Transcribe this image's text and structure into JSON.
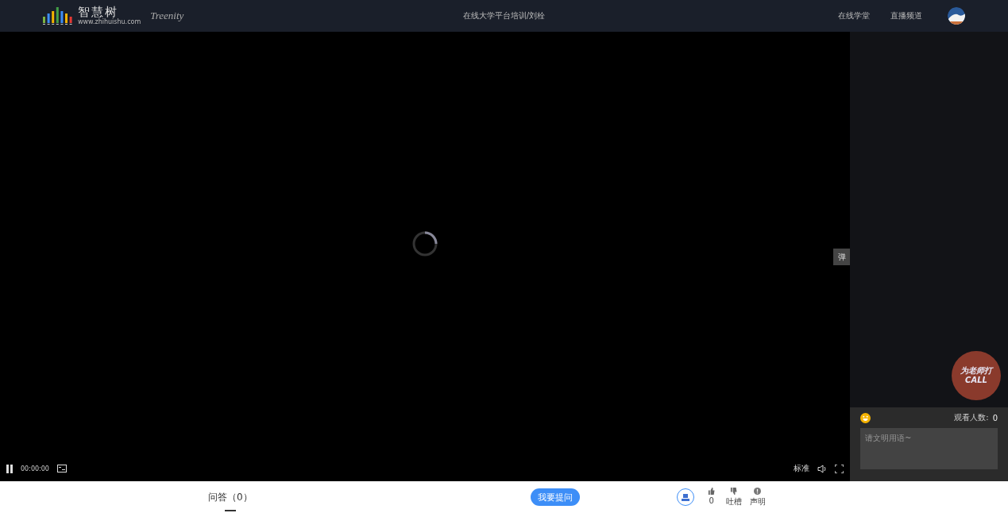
{
  "header": {
    "logo_text": "智慧树",
    "logo_url": "www.zhihuishu.com",
    "brand": "Treenity",
    "title": "在线大学平台培训/刘栓",
    "nav": [
      {
        "label": "在线学堂"
      },
      {
        "label": "直播频道"
      }
    ]
  },
  "player": {
    "danmaku_toggle": "弹",
    "time": "00:00:00",
    "quality": "标准"
  },
  "chat": {
    "call_badge": "为老师打CALL",
    "viewers_label": "观看人数:",
    "viewers": "0",
    "placeholder": "请文明用语~"
  },
  "bottom": {
    "tabs": [
      {
        "label": "问答（0）",
        "selected": true
      }
    ],
    "ask_button": "我要提问",
    "actions": [
      {
        "kind": "like",
        "label": "0"
      },
      {
        "kind": "dislike",
        "label": "吐槽"
      },
      {
        "kind": "notice",
        "label": "声明"
      }
    ]
  }
}
